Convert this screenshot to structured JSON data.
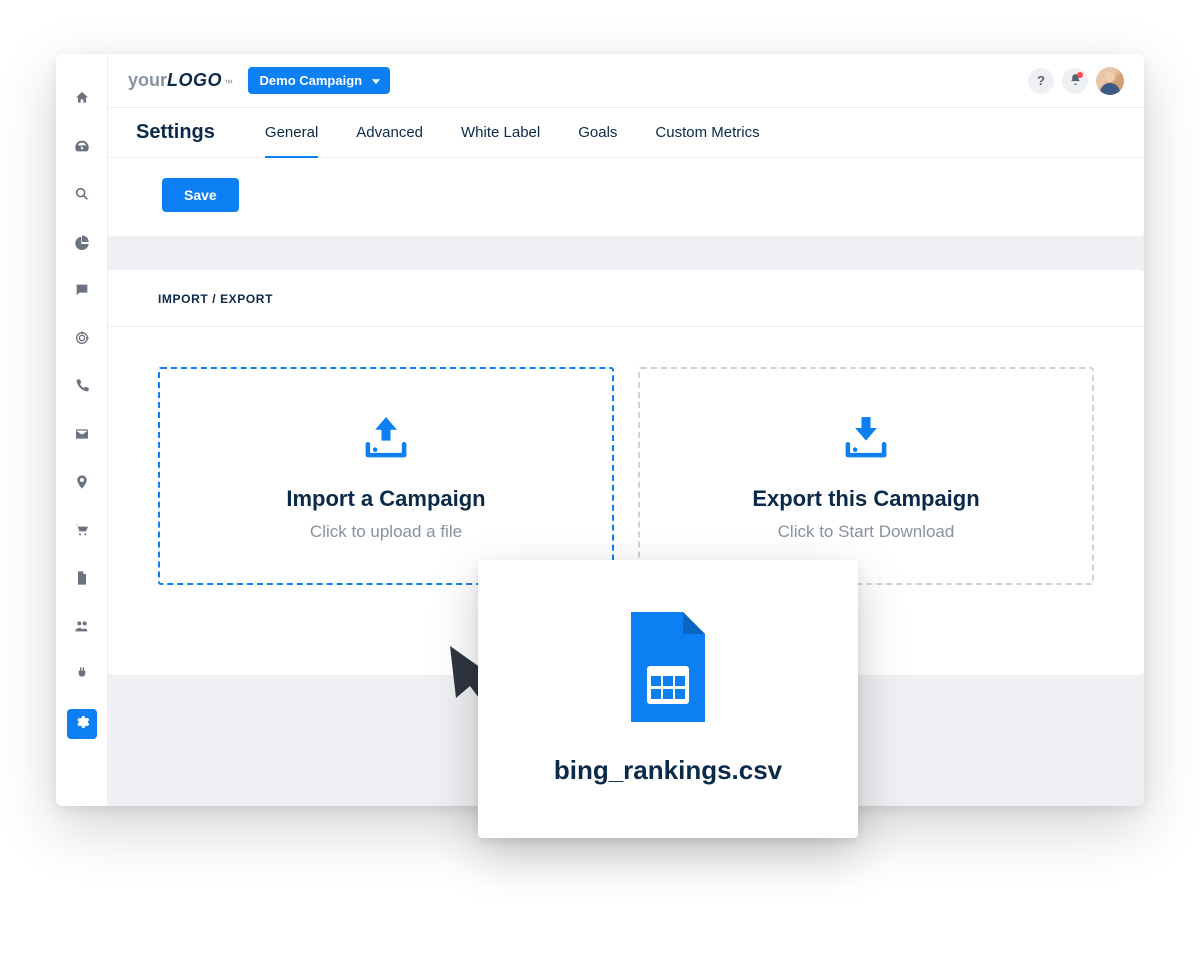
{
  "logo": {
    "pre": "your",
    "main": "LOGO",
    "tm": "™"
  },
  "campaign_selector": {
    "label": "Demo Campaign"
  },
  "topbar": {
    "help": "?",
    "notifications_dot": true
  },
  "page": {
    "title": "Settings"
  },
  "tabs": [
    {
      "label": "General",
      "active": true
    },
    {
      "label": "Advanced",
      "active": false
    },
    {
      "label": "White Label",
      "active": false
    },
    {
      "label": "Goals",
      "active": false
    },
    {
      "label": "Custom Metrics",
      "active": false
    }
  ],
  "save": {
    "label": "Save"
  },
  "panel": {
    "header": "IMPORT / EXPORT"
  },
  "import_box": {
    "title": "Import a Campaign",
    "subtitle": "Click to upload a file"
  },
  "export_box": {
    "title": "Export this Campaign",
    "subtitle": "Click to Start Download"
  },
  "drag_file": {
    "name": "bing_rankings.csv"
  },
  "sidebar": {
    "items": [
      {
        "name": "home"
      },
      {
        "name": "dashboard"
      },
      {
        "name": "search"
      },
      {
        "name": "analytics"
      },
      {
        "name": "chat"
      },
      {
        "name": "target"
      },
      {
        "name": "phone"
      },
      {
        "name": "mail"
      },
      {
        "name": "location"
      },
      {
        "name": "cart"
      },
      {
        "name": "file"
      },
      {
        "name": "users"
      },
      {
        "name": "plugin"
      },
      {
        "name": "settings",
        "active": true
      }
    ]
  }
}
